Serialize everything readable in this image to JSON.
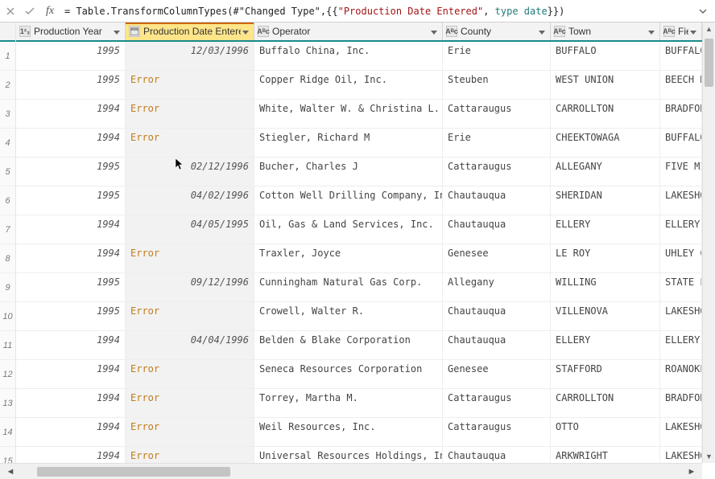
{
  "formula": {
    "fn": "= Table.TransformColumnTypes",
    "arg_ref": "#\"Changed Type\"",
    "col_name": "\"Production Date Entered\"",
    "type_kw": "type date",
    "tail": "}})"
  },
  "columns": [
    {
      "label": "Production Year",
      "type_icon": "1²₃",
      "selected": false
    },
    {
      "label": "Production Date Entered",
      "type_icon": "📅",
      "selected": true
    },
    {
      "label": "Operator",
      "type_icon": "Aᴮc",
      "selected": false
    },
    {
      "label": "County",
      "type_icon": "Aᴮc",
      "selected": false
    },
    {
      "label": "Town",
      "type_icon": "Aᴮc",
      "selected": false
    },
    {
      "label": "Field",
      "type_icon": "Aᴮc",
      "selected": false
    }
  ],
  "rows": [
    {
      "n": "1",
      "year": "1995",
      "date": "12/03/1996",
      "err": false,
      "op": "Buffalo China, Inc.",
      "county": "Erie",
      "town": "BUFFALO",
      "field": "BUFFALO"
    },
    {
      "n": "2",
      "year": "1995",
      "date": "Error",
      "err": true,
      "op": "Copper Ridge Oil, Inc.",
      "county": "Steuben",
      "town": "WEST UNION",
      "field": "BEECH H"
    },
    {
      "n": "3",
      "year": "1994",
      "date": "Error",
      "err": true,
      "op": "White, Walter W. & Christina L.",
      "county": "Cattaraugus",
      "town": "CARROLLTON",
      "field": "BRADFOR"
    },
    {
      "n": "4",
      "year": "1994",
      "date": "Error",
      "err": true,
      "op": "Stiegler, Richard M",
      "county": "Erie",
      "town": "CHEEKTOWAGA",
      "field": "BUFFALO"
    },
    {
      "n": "5",
      "year": "1995",
      "date": "02/12/1996",
      "err": false,
      "op": "Bucher, Charles J",
      "county": "Cattaraugus",
      "town": "ALLEGANY",
      "field": "FIVE MI"
    },
    {
      "n": "6",
      "year": "1995",
      "date": "04/02/1996",
      "err": false,
      "op": "Cotton Well Drilling Company,  Inc.",
      "county": "Chautauqua",
      "town": "SHERIDAN",
      "field": "LAKESHO"
    },
    {
      "n": "7",
      "year": "1994",
      "date": "04/05/1995",
      "err": false,
      "op": "Oil, Gas & Land Services, Inc.",
      "county": "Chautauqua",
      "town": "ELLERY",
      "field": "ELLERY "
    },
    {
      "n": "8",
      "year": "1994",
      "date": "Error",
      "err": true,
      "op": "Traxler, Joyce",
      "county": "Genesee",
      "town": "LE ROY",
      "field": "UHLEY C"
    },
    {
      "n": "9",
      "year": "1995",
      "date": "09/12/1996",
      "err": false,
      "op": "Cunningham Natural Gas Corp.",
      "county": "Allegany",
      "town": "WILLING",
      "field": "STATE L"
    },
    {
      "n": "10",
      "year": "1995",
      "date": "Error",
      "err": true,
      "op": "Crowell, Walter R.",
      "county": "Chautauqua",
      "town": "VILLENOVA",
      "field": "LAKESHO"
    },
    {
      "n": "11",
      "year": "1994",
      "date": "04/04/1996",
      "err": false,
      "op": "Belden & Blake Corporation",
      "county": "Chautauqua",
      "town": "ELLERY",
      "field": "ELLERY "
    },
    {
      "n": "12",
      "year": "1994",
      "date": "Error",
      "err": true,
      "op": "Seneca Resources Corporation",
      "county": "Genesee",
      "town": "STAFFORD",
      "field": "ROANOKE"
    },
    {
      "n": "13",
      "year": "1994",
      "date": "Error",
      "err": true,
      "op": "Torrey, Martha M.",
      "county": "Cattaraugus",
      "town": "CARROLLTON",
      "field": "BRADFOR"
    },
    {
      "n": "14",
      "year": "1994",
      "date": "Error",
      "err": true,
      "op": "Weil Resources, Inc.",
      "county": "Cattaraugus",
      "town": "OTTO",
      "field": "LAKESHO"
    },
    {
      "n": "15",
      "year": "1994",
      "date": "Error",
      "err": true,
      "op": "Universal Resources Holdings, Incorp.",
      "county": "Chautauqua",
      "town": "ARKWRIGHT",
      "field": "LAKESHO"
    }
  ]
}
